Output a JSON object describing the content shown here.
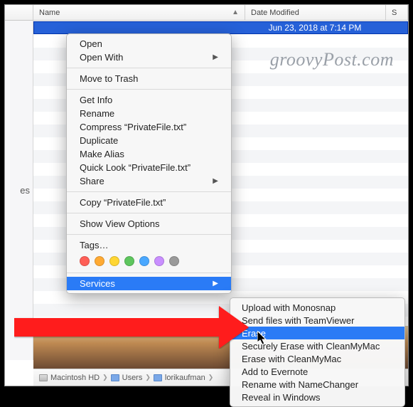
{
  "header": {
    "name": "Name",
    "date": "Date Modified",
    "s": "S"
  },
  "file": {
    "name": "",
    "date": "Jun 23, 2018 at 7:14 PM"
  },
  "watermark": "groovyPost.com",
  "menu": {
    "open": "Open",
    "openwith": "Open With",
    "trash": "Move to Trash",
    "getinfo": "Get Info",
    "rename": "Rename",
    "compress": "Compress “PrivateFile.txt”",
    "duplicate": "Duplicate",
    "alias": "Make Alias",
    "quicklook": "Quick Look “PrivateFile.txt”",
    "share": "Share",
    "copy": "Copy “PrivateFile.txt”",
    "viewopts": "Show View Options",
    "tags": "Tags…",
    "services": "Services"
  },
  "tag_colors": [
    "#ff5f57",
    "#ffaa33",
    "#ffd633",
    "#5ec65e",
    "#4aa8ff",
    "#c98fff",
    "#9a9a9a"
  ],
  "submenu": {
    "items": [
      "Upload with Monosnap",
      "Send files with TeamViewer",
      "Erase",
      "Securely Erase with CleanMyMac",
      "Erase with CleanMyMac",
      "Add to Evernote",
      "Rename with NameChanger",
      "Reveal in Windows"
    ],
    "highlight_index": 2
  },
  "path": {
    "a": "Macintosh HD",
    "b": "Users",
    "c": "lorikaufman"
  },
  "sidebar_glimpse": "es"
}
